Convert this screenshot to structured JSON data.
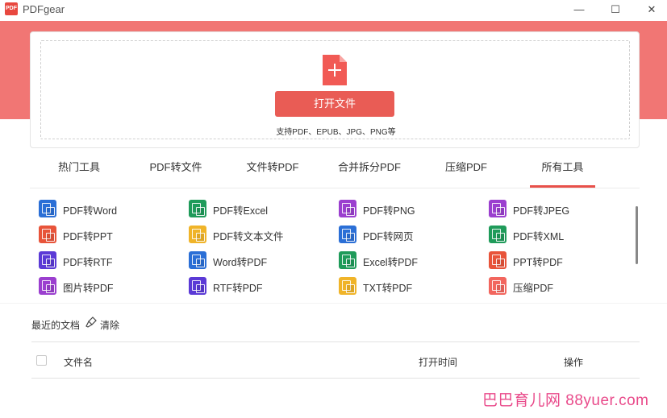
{
  "window": {
    "logo_text": "PDF",
    "title": "PDFgear",
    "minimize": "—",
    "maximize": "☐",
    "close": "✕"
  },
  "open_panel": {
    "button_label": "打开文件",
    "support_text": "支持PDF、EPUB、JPG、PNG等"
  },
  "tabs": [
    {
      "label": "热门工具",
      "active": false
    },
    {
      "label": "PDF转文件",
      "active": false
    },
    {
      "label": "文件转PDF",
      "active": false
    },
    {
      "label": "合并拆分PDF",
      "active": false
    },
    {
      "label": "压缩PDF",
      "active": false
    },
    {
      "label": "所有工具",
      "active": true
    }
  ],
  "tools": [
    [
      {
        "label": "PDF转Word",
        "icon": "word-convert-icon",
        "color": "#2b6fd6"
      },
      {
        "label": "PDF转Excel",
        "icon": "excel-convert-icon",
        "color": "#1f9b5a"
      },
      {
        "label": "PDF转PNG",
        "icon": "png-convert-icon",
        "color": "#9b3fcf"
      },
      {
        "label": "PDF转JPEG",
        "icon": "jpeg-convert-icon",
        "color": "#9b3fcf"
      }
    ],
    [
      {
        "label": "PDF转PPT",
        "icon": "ppt-convert-icon",
        "color": "#e8543a"
      },
      {
        "label": "PDF转文本文件",
        "icon": "text-convert-icon",
        "color": "#f0b429"
      },
      {
        "label": "PDF转网页",
        "icon": "web-convert-icon",
        "color": "#2b6fd6"
      },
      {
        "label": "PDF转XML",
        "icon": "xml-convert-icon",
        "color": "#1f9b5a"
      }
    ],
    [
      {
        "label": "PDF转RTF",
        "icon": "rtf-convert-icon",
        "color": "#5b3ad6"
      },
      {
        "label": "Word转PDF",
        "icon": "word-to-pdf-icon",
        "color": "#2b6fd6"
      },
      {
        "label": "Excel转PDF",
        "icon": "excel-to-pdf-icon",
        "color": "#1f9b5a"
      },
      {
        "label": "PPT转PDF",
        "icon": "ppt-to-pdf-icon",
        "color": "#e8543a"
      }
    ],
    [
      {
        "label": "图片转PDF",
        "icon": "image-to-pdf-icon",
        "color": "#9b3fcf"
      },
      {
        "label": "RTF转PDF",
        "icon": "rtf-to-pdf-icon",
        "color": "#5b3ad6"
      },
      {
        "label": "TXT转PDF",
        "icon": "txt-to-pdf-icon",
        "color": "#f0b429"
      },
      {
        "label": "压缩PDF",
        "icon": "compress-pdf-icon",
        "color": "#f2665e"
      }
    ]
  ],
  "recent": {
    "title": "最近的文档",
    "clear_label": "清除",
    "columns": {
      "name": "文件名",
      "time": "打开时间",
      "action": "操作"
    }
  },
  "watermark": "巴巴育儿网 88yuer.com",
  "colors": {
    "banner": "#f17674",
    "accent": "#e95c55"
  }
}
